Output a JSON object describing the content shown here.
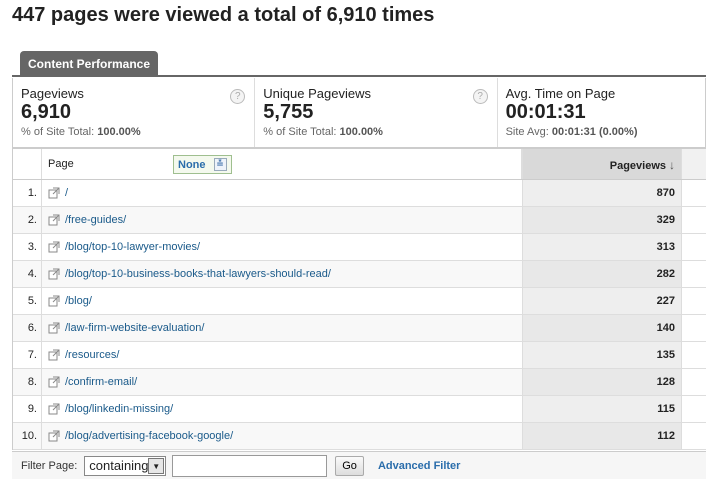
{
  "headline": "447 pages were viewed a total of 6,910 times",
  "tab": {
    "label": "Content Performance"
  },
  "metrics": [
    {
      "title": "Pageviews",
      "value": "6,910",
      "sub_label": "% of Site Total:",
      "sub_value": "100.00%"
    },
    {
      "title": "Unique Pageviews",
      "value": "5,755",
      "sub_label": "% of Site Total:",
      "sub_value": "100.00%"
    },
    {
      "title": "Avg. Time on Page",
      "value": "00:01:31",
      "sub_label": "Site Avg:",
      "sub_value": "00:01:31 (0.00%)"
    }
  ],
  "help_glyph": "?",
  "table": {
    "col_page": "Page",
    "secondary_dimension": "None",
    "col_pageviews": "Pageviews",
    "rows": [
      {
        "num": "1.",
        "page": "/",
        "pageviews": "870"
      },
      {
        "num": "2.",
        "page": "/free-guides/",
        "pageviews": "329"
      },
      {
        "num": "3.",
        "page": "/blog/top-10-lawyer-movies/",
        "pageviews": "313"
      },
      {
        "num": "4.",
        "page": "/blog/top-10-business-books-that-lawyers-should-read/",
        "pageviews": "282"
      },
      {
        "num": "5.",
        "page": "/blog/",
        "pageviews": "227"
      },
      {
        "num": "6.",
        "page": "/law-firm-website-evaluation/",
        "pageviews": "140"
      },
      {
        "num": "7.",
        "page": "/resources/",
        "pageviews": "135"
      },
      {
        "num": "8.",
        "page": "/confirm-email/",
        "pageviews": "128"
      },
      {
        "num": "9.",
        "page": "/blog/linkedin-missing/",
        "pageviews": "115"
      },
      {
        "num": "10.",
        "page": "/blog/advertising-facebook-google/",
        "pageviews": "112"
      }
    ]
  },
  "filter": {
    "label": "Filter Page:",
    "select_value": "containing",
    "input_value": "",
    "go_label": "Go",
    "advanced_label": "Advanced Filter"
  },
  "colors": {
    "link": "#1a5a8a",
    "tab": "#666666",
    "accent": "#2a6dab"
  }
}
